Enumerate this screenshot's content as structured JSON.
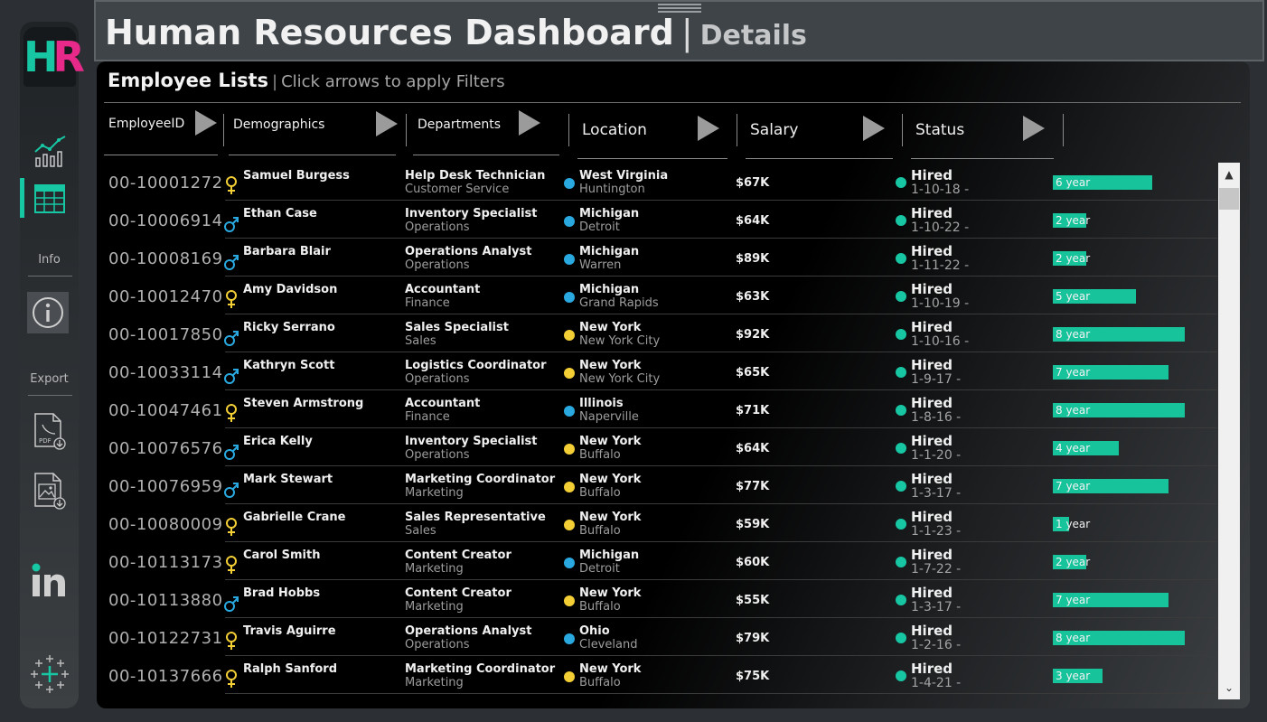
{
  "colors": {
    "accent": "#17c7a4",
    "logo_r": "#e7298a",
    "michigan_dot": "#29a9e0",
    "newyork_dot": "#f3cf35",
    "hired_dot": "#17c7a4",
    "bar": "#16c39b"
  },
  "sidebar": {
    "logo": {
      "h": "H",
      "r": "R"
    },
    "icons": [
      "line-chart-icon",
      "table-icon",
      "info-icon",
      "pdf-export-icon",
      "image-export-icon",
      "linkedin-icon",
      "tableau-icon"
    ],
    "info_label": "Info",
    "export_label": "Export"
  },
  "header": {
    "title": "Human Resources Dashboard",
    "separator": "|",
    "subtitle": "Details"
  },
  "panel": {
    "title": "Employee Lists",
    "separator": "|",
    "hint": "Click arrows to apply Filters",
    "filters": [
      "EmployeeID",
      "Demographics",
      "Departments",
      "Location",
      "Salary",
      "Status"
    ]
  },
  "employees": [
    {
      "id": "00-10001272",
      "gender": "female",
      "name": "Samuel Burgess",
      "job": "Help Desk Technician",
      "dept": "Customer Service",
      "state": "West Virginia",
      "city": "Huntington",
      "dot": "blue",
      "salary": "$67K",
      "status": "Hired",
      "date": "1-10-18 -",
      "years": 6,
      "years_label": "6 year"
    },
    {
      "id": "00-10006914",
      "gender": "male",
      "name": "Ethan Case",
      "job": "Inventory Specialist",
      "dept": "Operations",
      "state": "Michigan",
      "city": "Detroit",
      "dot": "blue",
      "salary": "$64K",
      "status": "Hired",
      "date": "1-10-22 -",
      "years": 2,
      "years_label": "2 year"
    },
    {
      "id": "00-10008169",
      "gender": "male",
      "name": "Barbara Blair",
      "job": "Operations Analyst",
      "dept": "Operations",
      "state": "Michigan",
      "city": "Warren",
      "dot": "blue",
      "salary": "$89K",
      "status": "Hired",
      "date": "1-11-22 -",
      "years": 2,
      "years_label": "2 year"
    },
    {
      "id": "00-10012470",
      "gender": "female",
      "name": "Amy Davidson",
      "job": "Accountant",
      "dept": "Finance",
      "state": "Michigan",
      "city": "Grand Rapids",
      "dot": "blue",
      "salary": "$63K",
      "status": "Hired",
      "date": "1-10-19 -",
      "years": 5,
      "years_label": "5 year"
    },
    {
      "id": "00-10017850",
      "gender": "male",
      "name": "Ricky Serrano",
      "job": "Sales Specialist",
      "dept": "Sales",
      "state": "New York",
      "city": "New York City",
      "dot": "yellow",
      "salary": "$92K",
      "status": "Hired",
      "date": "1-10-16 -",
      "years": 8,
      "years_label": "8 year"
    },
    {
      "id": "00-10033114",
      "gender": "male",
      "name": "Kathryn Scott",
      "job": "Logistics Coordinator",
      "dept": "Operations",
      "state": "New York",
      "city": "New York City",
      "dot": "yellow",
      "salary": "$65K",
      "status": "Hired",
      "date": "1-9-17 -",
      "years": 7,
      "years_label": "7 year"
    },
    {
      "id": "00-10047461",
      "gender": "female",
      "name": "Steven Armstrong",
      "job": "Accountant",
      "dept": "Finance",
      "state": "Illinois",
      "city": "Naperville",
      "dot": "blue",
      "salary": "$71K",
      "status": "Hired",
      "date": "1-8-16 -",
      "years": 8,
      "years_label": "8 year"
    },
    {
      "id": "00-10076576",
      "gender": "male",
      "name": "Erica Kelly",
      "job": "Inventory Specialist",
      "dept": "Operations",
      "state": "New York",
      "city": "Buffalo",
      "dot": "yellow",
      "salary": "$64K",
      "status": "Hired",
      "date": "1-1-20 -",
      "years": 4,
      "years_label": "4 year"
    },
    {
      "id": "00-10076959",
      "gender": "male",
      "name": "Mark Stewart",
      "job": "Marketing Coordinator",
      "dept": "Marketing",
      "state": "New York",
      "city": "Buffalo",
      "dot": "yellow",
      "salary": "$77K",
      "status": "Hired",
      "date": "1-3-17 -",
      "years": 7,
      "years_label": "7 year"
    },
    {
      "id": "00-10080009",
      "gender": "female",
      "name": "Gabrielle Crane",
      "job": "Sales Representative",
      "dept": "Sales",
      "state": "New York",
      "city": "Buffalo",
      "dot": "yellow",
      "salary": "$59K",
      "status": "Hired",
      "date": "1-1-23 -",
      "years": 1,
      "years_label": "1 year"
    },
    {
      "id": "00-10113173",
      "gender": "female",
      "name": "Carol Smith",
      "job": "Content Creator",
      "dept": "Marketing",
      "state": "Michigan",
      "city": "Detroit",
      "dot": "blue",
      "salary": "$60K",
      "status": "Hired",
      "date": "1-7-22 -",
      "years": 2,
      "years_label": "2 year"
    },
    {
      "id": "00-10113880",
      "gender": "male",
      "name": "Brad Hobbs",
      "job": "Content Creator",
      "dept": "Marketing",
      "state": "New York",
      "city": "Buffalo",
      "dot": "yellow",
      "salary": "$55K",
      "status": "Hired",
      "date": "1-3-17 -",
      "years": 7,
      "years_label": "7 year"
    },
    {
      "id": "00-10122731",
      "gender": "female",
      "name": "Travis Aguirre",
      "job": "Operations Analyst",
      "dept": "Operations",
      "state": "Ohio",
      "city": "Cleveland",
      "dot": "blue",
      "salary": "$79K",
      "status": "Hired",
      "date": "1-2-16 -",
      "years": 8,
      "years_label": "8 year"
    },
    {
      "id": "00-10137666",
      "gender": "female",
      "name": "Ralph Sanford",
      "job": "Marketing Coordinator",
      "dept": "Marketing",
      "state": "New York",
      "city": "Buffalo",
      "dot": "yellow",
      "salary": "$75K",
      "status": "Hired",
      "date": "1-4-21 -",
      "years": 3,
      "years_label": "3 year"
    }
  ]
}
